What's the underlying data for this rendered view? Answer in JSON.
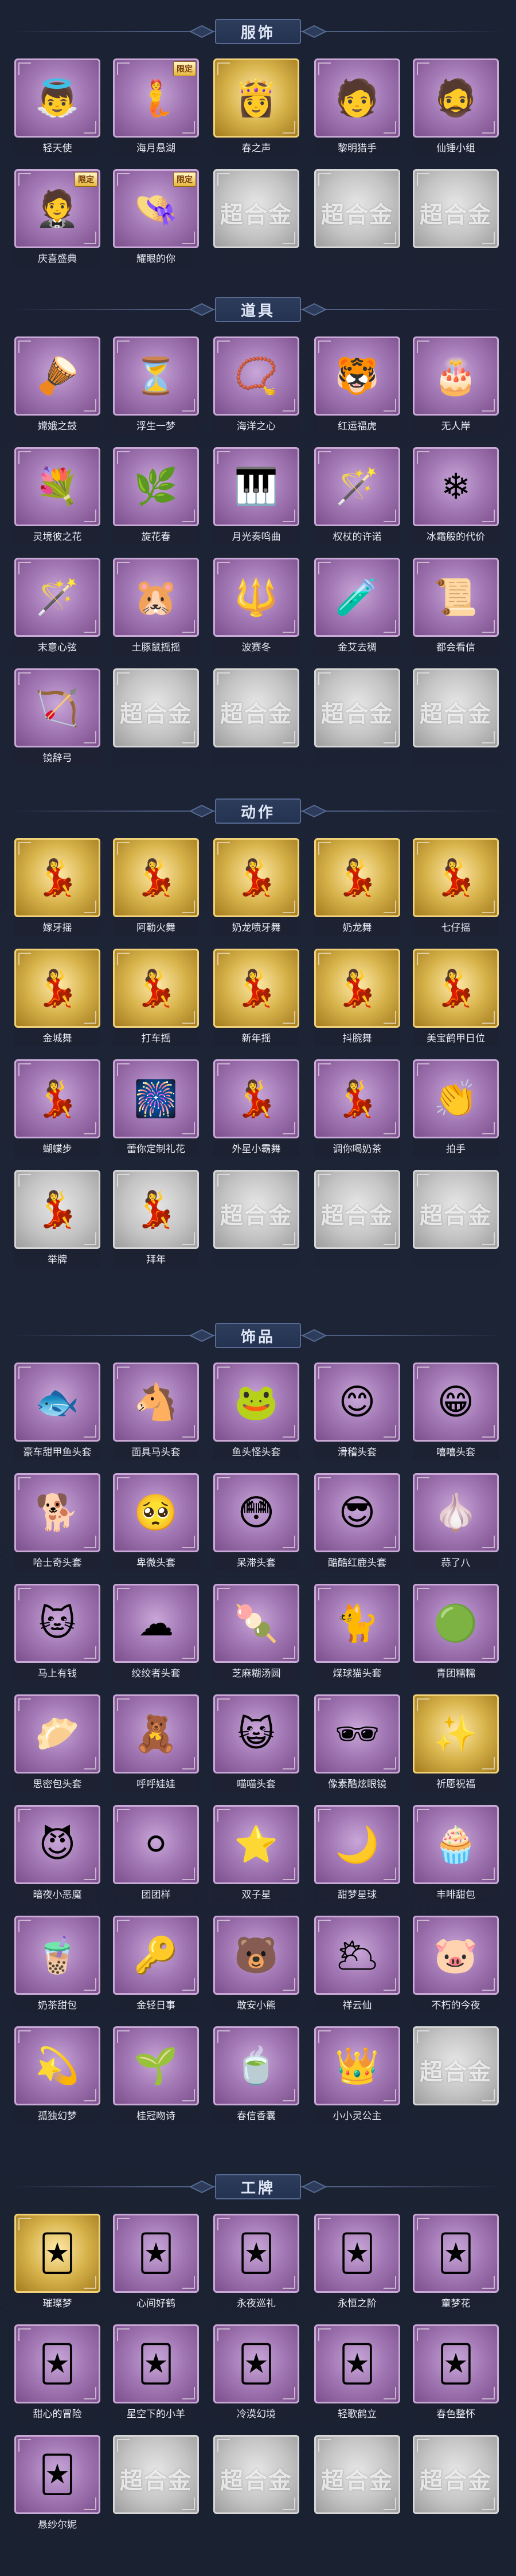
{
  "sections": [
    {
      "title": "服饰",
      "items": [
        {
          "label": "轻天使",
          "tier": "purple",
          "icon": "angel-costume-icon",
          "badge": ""
        },
        {
          "label": "海月悬湖",
          "tier": "purple",
          "icon": "sea-costume-icon",
          "badge": "限定"
        },
        {
          "label": "春之声",
          "tier": "gold",
          "icon": "spring-costume-icon",
          "badge": ""
        },
        {
          "label": "黎明猎手",
          "tier": "purple",
          "icon": "hunter-costume-icon",
          "badge": ""
        },
        {
          "label": "仙锤小组",
          "tier": "purple",
          "icon": "hammer-costume-icon",
          "badge": ""
        },
        {
          "label": "庆喜盛典",
          "tier": "purple",
          "icon": "celebration-costume-icon",
          "badge": "限定"
        },
        {
          "label": "耀眼的你",
          "tier": "purple",
          "icon": "dazzle-costume-icon",
          "badge": "限定"
        },
        {
          "label": "",
          "tier": "gray",
          "icon": "locked-placeholder-icon",
          "badge": ""
        },
        {
          "label": "",
          "tier": "gray",
          "icon": "locked-placeholder-icon",
          "badge": ""
        },
        {
          "label": "",
          "tier": "gray",
          "icon": "locked-placeholder-icon",
          "badge": ""
        }
      ]
    },
    {
      "title": "道具",
      "items": [
        {
          "label": "嫦娥之鼓",
          "tier": "purple",
          "icon": "drum-icon",
          "badge": ""
        },
        {
          "label": "浮生一梦",
          "tier": "purple",
          "icon": "hourglass-icon",
          "badge": ""
        },
        {
          "label": "海洋之心",
          "tier": "purple",
          "icon": "necklace-icon",
          "badge": ""
        },
        {
          "label": "红运福虎",
          "tier": "purple",
          "icon": "tiger-icon",
          "badge": ""
        },
        {
          "label": "无人岸",
          "tier": "purple",
          "icon": "cake-icon",
          "badge": ""
        },
        {
          "label": "灵境彼之花",
          "tier": "purple",
          "icon": "flower-icon",
          "badge": ""
        },
        {
          "label": "旋花春",
          "tier": "purple",
          "icon": "wreath-icon",
          "badge": ""
        },
        {
          "label": "月光奏鸣曲",
          "tier": "purple",
          "icon": "piano-icon",
          "badge": ""
        },
        {
          "label": "权杖的许诺",
          "tier": "purple",
          "icon": "scepter-icon",
          "badge": ""
        },
        {
          "label": "冰霜般的代价",
          "tier": "purple",
          "icon": "ice-rose-icon",
          "badge": ""
        },
        {
          "label": "末意心弦",
          "tier": "purple",
          "icon": "wand-icon",
          "badge": ""
        },
        {
          "label": "土豚鼠摇摇",
          "tier": "purple",
          "icon": "rodent-icon",
          "badge": ""
        },
        {
          "label": "波赛冬",
          "tier": "purple",
          "icon": "trident-icon",
          "badge": ""
        },
        {
          "label": "金艾去稠",
          "tier": "purple",
          "icon": "bottle-icon",
          "badge": ""
        },
        {
          "label": "都会看信",
          "tier": "purple",
          "icon": "scroll-icon",
          "badge": ""
        },
        {
          "label": "镜辞弓",
          "tier": "purple",
          "icon": "bow-icon",
          "badge": ""
        },
        {
          "label": "",
          "tier": "gray",
          "icon": "locked-placeholder-icon",
          "badge": ""
        },
        {
          "label": "",
          "tier": "gray",
          "icon": "locked-placeholder-icon",
          "badge": ""
        },
        {
          "label": "",
          "tier": "gray",
          "icon": "locked-placeholder-icon",
          "badge": ""
        },
        {
          "label": "",
          "tier": "gray",
          "icon": "locked-placeholder-icon",
          "badge": ""
        }
      ]
    },
    {
      "title": "动作",
      "items": [
        {
          "label": "嫁牙摇",
          "tier": "gold",
          "icon": "dance-pose-icon",
          "badge": ""
        },
        {
          "label": "阿勒火舞",
          "tier": "gold",
          "icon": "dance-pose-icon",
          "badge": ""
        },
        {
          "label": "奶龙喷牙舞",
          "tier": "gold",
          "icon": "dance-pose-icon",
          "badge": ""
        },
        {
          "label": "奶龙舞",
          "tier": "gold",
          "icon": "dance-pose-icon",
          "badge": ""
        },
        {
          "label": "七仔摇",
          "tier": "gold",
          "icon": "dance-pose-icon",
          "badge": ""
        },
        {
          "label": "金城舞",
          "tier": "gold",
          "icon": "dance-pose-icon",
          "badge": ""
        },
        {
          "label": "打车摇",
          "tier": "gold",
          "icon": "dance-pose-icon",
          "badge": ""
        },
        {
          "label": "新年摇",
          "tier": "gold",
          "icon": "dance-pose-icon",
          "badge": ""
        },
        {
          "label": "抖腕舞",
          "tier": "gold",
          "icon": "dance-pose-icon",
          "badge": ""
        },
        {
          "label": "美宝鹤甲日位",
          "tier": "gold",
          "icon": "dance-pose-icon",
          "badge": ""
        },
        {
          "label": "蝴蝶步",
          "tier": "purple",
          "icon": "dance-pose-icon",
          "badge": ""
        },
        {
          "label": "蕾你定制礼花",
          "tier": "purple",
          "icon": "firework-icon",
          "badge": ""
        },
        {
          "label": "外星小霸舞",
          "tier": "purple",
          "icon": "dance-pose-icon",
          "badge": ""
        },
        {
          "label": "调你喝奶茶",
          "tier": "purple",
          "icon": "dance-pose-icon",
          "badge": ""
        },
        {
          "label": "拍手",
          "tier": "purple",
          "icon": "clap-icon",
          "badge": ""
        },
        {
          "label": "举牌",
          "tier": "gray",
          "icon": "dance-pose-icon",
          "badge": ""
        },
        {
          "label": "拜年",
          "tier": "gray",
          "icon": "dance-pose-icon",
          "badge": ""
        },
        {
          "label": "",
          "tier": "gray",
          "icon": "locked-placeholder-icon",
          "badge": ""
        },
        {
          "label": "",
          "tier": "gray",
          "icon": "locked-placeholder-icon",
          "badge": ""
        },
        {
          "label": "",
          "tier": "gray",
          "icon": "locked-placeholder-icon",
          "badge": ""
        }
      ]
    },
    {
      "title": "饰品",
      "items": [
        {
          "label": "豪车甜甲鱼头套",
          "tier": "purple",
          "icon": "fish-head-icon",
          "badge": ""
        },
        {
          "label": "面具马头套",
          "tier": "purple",
          "icon": "horse-head-icon",
          "badge": ""
        },
        {
          "label": "鱼头怪头套",
          "tier": "purple",
          "icon": "frog-head-icon",
          "badge": ""
        },
        {
          "label": "滑稽头套",
          "tier": "purple",
          "icon": "smile-emoji-icon",
          "badge": ""
        },
        {
          "label": "嘻嘻头套",
          "tier": "purple",
          "icon": "grin-emoji-icon",
          "badge": ""
        },
        {
          "label": "哈士奇头套",
          "tier": "purple",
          "icon": "dog-head-icon",
          "badge": ""
        },
        {
          "label": "卑微头套",
          "tier": "purple",
          "icon": "meek-emoji-icon",
          "badge": ""
        },
        {
          "label": "呆滞头套",
          "tier": "purple",
          "icon": "dazed-emoji-icon",
          "badge": ""
        },
        {
          "label": "酷酷红鹿头套",
          "tier": "purple",
          "icon": "cool-pikachu-icon",
          "badge": ""
        },
        {
          "label": "蒜了八",
          "tier": "purple",
          "icon": "garlic-icon",
          "badge": ""
        },
        {
          "label": "马上有钱",
          "tier": "purple",
          "icon": "lucky-cat-icon",
          "badge": ""
        },
        {
          "label": "绞绞者头套",
          "tier": "purple",
          "icon": "cloud-head-icon",
          "badge": ""
        },
        {
          "label": "芝麻糊汤圆",
          "tier": "purple",
          "icon": "dumpling-icon",
          "badge": ""
        },
        {
          "label": "煤球猫头套",
          "tier": "purple",
          "icon": "black-cat-icon",
          "badge": ""
        },
        {
          "label": "青团糯糯",
          "tier": "purple",
          "icon": "green-ball-icon",
          "badge": ""
        },
        {
          "label": "思密包头套",
          "tier": "purple",
          "icon": "bun-head-icon",
          "badge": ""
        },
        {
          "label": "呼呼娃娃",
          "tier": "purple",
          "icon": "doll-icon",
          "badge": ""
        },
        {
          "label": "喵喵头套",
          "tier": "purple",
          "icon": "tabby-cat-icon",
          "badge": ""
        },
        {
          "label": "像素酷炫眼镜",
          "tier": "purple",
          "icon": "pixel-glasses-icon",
          "badge": ""
        },
        {
          "label": "祈愿祝福",
          "tier": "gold",
          "icon": "blessing-icon",
          "badge": ""
        },
        {
          "label": "暗夜小恶魔",
          "tier": "purple",
          "icon": "devil-icon",
          "badge": ""
        },
        {
          "label": "团团样",
          "tier": "purple",
          "icon": "round-icon",
          "badge": ""
        },
        {
          "label": "双子星",
          "tier": "purple",
          "icon": "twin-star-icon",
          "badge": ""
        },
        {
          "label": "甜梦星球",
          "tier": "purple",
          "icon": "moon-planet-icon",
          "badge": ""
        },
        {
          "label": "丰啡甜包",
          "tier": "purple",
          "icon": "cake-bag-icon",
          "badge": ""
        },
        {
          "label": "奶茶甜包",
          "tier": "purple",
          "icon": "milk-tea-bag-icon",
          "badge": ""
        },
        {
          "label": "金轻日事",
          "tier": "purple",
          "icon": "keychain-icon",
          "badge": ""
        },
        {
          "label": "敢安小熊",
          "tier": "purple",
          "icon": "bear-charm-icon",
          "badge": ""
        },
        {
          "label": "祥云仙",
          "tier": "purple",
          "icon": "cloud-charm-icon",
          "badge": ""
        },
        {
          "label": "不朽的今夜",
          "tier": "purple",
          "icon": "pig-charm-icon",
          "badge": ""
        },
        {
          "label": "孤独幻梦",
          "tier": "purple",
          "icon": "dream-charm-icon",
          "badge": ""
        },
        {
          "label": "桂冠吻诗",
          "tier": "purple",
          "icon": "laurel-charm-icon",
          "badge": ""
        },
        {
          "label": "春信香囊",
          "tier": "purple",
          "icon": "sachet-icon",
          "badge": ""
        },
        {
          "label": "小小灵公主",
          "tier": "purple",
          "icon": "princess-charm-icon",
          "badge": ""
        },
        {
          "label": "",
          "tier": "gray",
          "icon": "locked-placeholder-icon",
          "badge": ""
        }
      ]
    },
    {
      "title": "工牌",
      "items": [
        {
          "label": "璀璨梦",
          "tier": "gold",
          "icon": "badge-card-icon",
          "badge": ""
        },
        {
          "label": "心间好鹤",
          "tier": "purple",
          "icon": "badge-card-icon",
          "badge": ""
        },
        {
          "label": "永夜巡礼",
          "tier": "purple",
          "icon": "badge-card-icon",
          "badge": ""
        },
        {
          "label": "永恒之阶",
          "tier": "purple",
          "icon": "badge-card-icon",
          "badge": ""
        },
        {
          "label": "童梦花",
          "tier": "purple",
          "icon": "badge-card-icon",
          "badge": ""
        },
        {
          "label": "甜心的冒险",
          "tier": "purple",
          "icon": "badge-card-icon",
          "badge": ""
        },
        {
          "label": "星空下的小羊",
          "tier": "purple",
          "icon": "badge-card-icon",
          "badge": ""
        },
        {
          "label": "冷漠幻境",
          "tier": "purple",
          "icon": "badge-card-icon",
          "badge": ""
        },
        {
          "label": "轻歌鹤立",
          "tier": "purple",
          "icon": "badge-card-icon",
          "badge": ""
        },
        {
          "label": "春色整怀",
          "tier": "purple",
          "icon": "badge-card-icon",
          "badge": ""
        },
        {
          "label": "悬纱尔妮",
          "tier": "purple",
          "icon": "badge-card-icon",
          "badge": ""
        },
        {
          "label": "",
          "tier": "gray",
          "icon": "locked-placeholder-icon",
          "badge": ""
        },
        {
          "label": "",
          "tier": "gray",
          "icon": "locked-placeholder-icon",
          "badge": ""
        },
        {
          "label": "",
          "tier": "gray",
          "icon": "locked-placeholder-icon",
          "badge": ""
        },
        {
          "label": "",
          "tier": "gray",
          "icon": "locked-placeholder-icon",
          "badge": ""
        }
      ]
    }
  ],
  "placeholder_text": "超合金",
  "colors": {
    "background": "#1b2233",
    "purple_tier": "#a47ab6",
    "gold_tier": "#d8b44c",
    "gray_tier": "#c4c4c4",
    "header_box": "#2e3c5c"
  }
}
